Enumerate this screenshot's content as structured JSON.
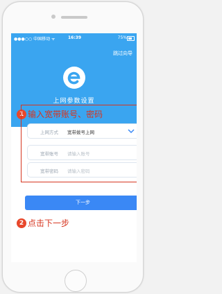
{
  "status_bar": {
    "carrier": "●●●○○ 中国移动 ᯤ",
    "time": "16:39",
    "battery": "75%"
  },
  "header": {
    "skip_label": "跳过向导",
    "title": "上网参数设置"
  },
  "annotations": {
    "step1_number": "1",
    "step1_text": "输入宽带账号、密码",
    "step2_number": "2",
    "step2_text": "点击下一步"
  },
  "form": {
    "mode_label": "上网方式",
    "mode_value": "宽带拨号上网",
    "account_label": "宽带账号",
    "account_placeholder": "请输入账号",
    "password_label": "宽带密码",
    "password_placeholder": "请输入密码"
  },
  "actions": {
    "next_label": "下一步"
  },
  "colors": {
    "header_blue": "#3aa5f0",
    "button_blue": "#3a88f5",
    "annotation_red": "#d6351f"
  }
}
